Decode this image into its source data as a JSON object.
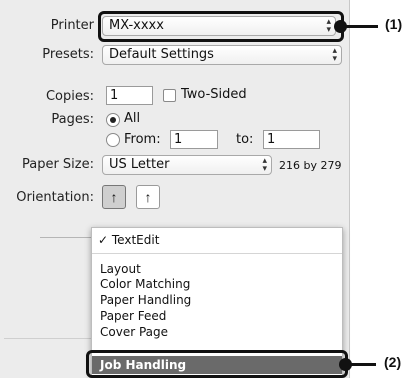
{
  "printer": {
    "label": "Printer",
    "value": "MX-xxxx"
  },
  "presets": {
    "label": "Presets:",
    "value": "Default Settings"
  },
  "copies": {
    "label": "Copies:",
    "value": "1",
    "two_sided_label": "Two-Sided"
  },
  "pages": {
    "label": "Pages:",
    "all_label": "All",
    "from_label": "From:",
    "from_value": "1",
    "to_label": "to:",
    "to_value": "1"
  },
  "paper_size": {
    "label": "Paper Size:",
    "value": "US Letter",
    "dims": "216 by 279"
  },
  "orientation": {
    "label": "Orientation:",
    "portrait_glyph": "↑",
    "landscape_glyph": "↑"
  },
  "menu": {
    "header_item": "TextEdit",
    "checkmark": "✓",
    "items": [
      "Layout",
      "Color Matching",
      "Paper Handling",
      "Paper Feed",
      "Cover Page"
    ],
    "selected_item": "Job Handling"
  },
  "callouts": {
    "one": "(1)",
    "two": "(2)"
  }
}
